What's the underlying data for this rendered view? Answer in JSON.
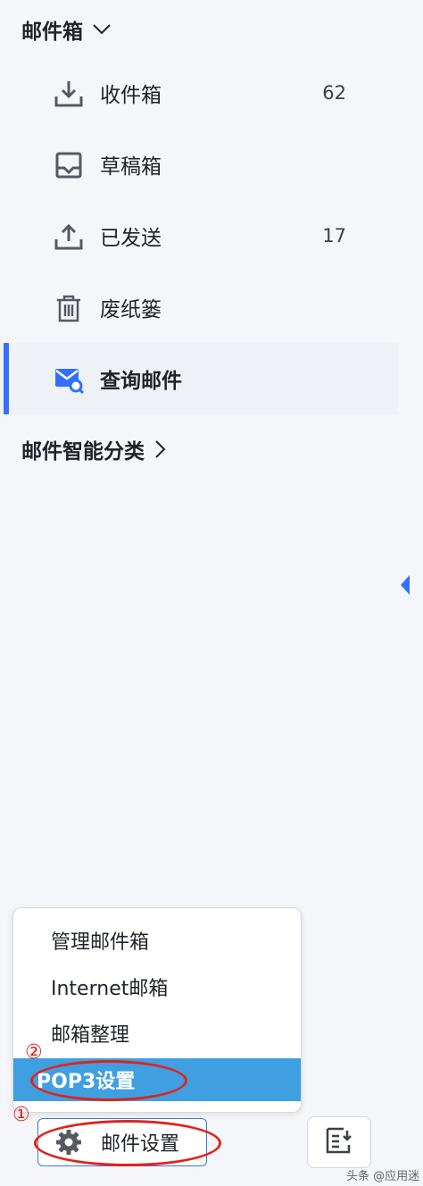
{
  "mailbox_header": {
    "label": "邮件箱"
  },
  "nav_items": [
    {
      "label": "收件箱",
      "count": "62",
      "icon": "inbox-download-icon"
    },
    {
      "label": "草稿箱",
      "count": "",
      "icon": "drafts-tray-icon"
    },
    {
      "label": "已发送",
      "count": "17",
      "icon": "sent-upload-icon"
    },
    {
      "label": "废纸篓",
      "count": "",
      "icon": "trash-icon"
    },
    {
      "label": "查询邮件",
      "count": "",
      "icon": "mail-search-icon",
      "active": true
    }
  ],
  "smart_category": {
    "label": "邮件智能分类"
  },
  "settings_menu": {
    "items": [
      "管理邮件箱",
      "Internet邮箱",
      "邮箱整理",
      "POP3设置"
    ],
    "highlighted_index": 3
  },
  "annotations": {
    "step1": "①",
    "step2": "②"
  },
  "footer": {
    "settings_label": "邮件设置",
    "export_icon": "export-icon"
  },
  "watermark": {
    "text": "头条 @应用迷"
  },
  "colors": {
    "accent": "#3370ff",
    "menu_highlight": "#3f9fe0",
    "annotation_red": "#e0231c"
  }
}
